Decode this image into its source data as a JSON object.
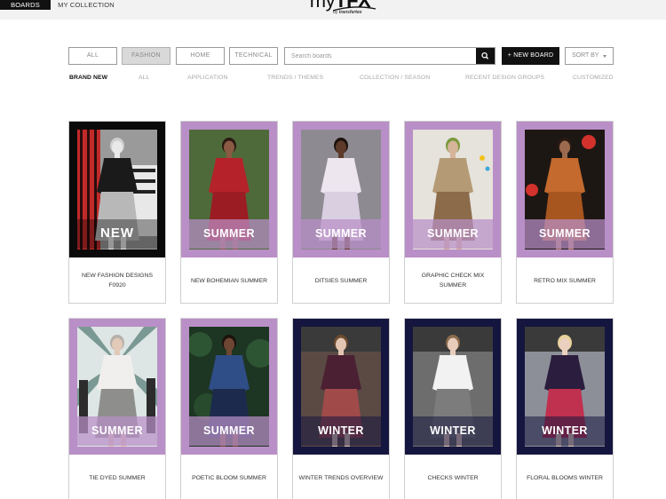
{
  "topbar": {
    "tabs": [
      {
        "label": "BOARDS",
        "active": true
      },
      {
        "label": "MY COLLECTION",
        "active": false
      }
    ],
    "logo": {
      "main_prefix": "my",
      "main_bold": "TFX",
      "sub_prefix": "by ",
      "sub_brand": "transfertex"
    }
  },
  "filters": {
    "buttons": [
      {
        "label": "ALL",
        "active": false
      },
      {
        "label": "FASHION",
        "active": true
      },
      {
        "label": "HOME",
        "active": false
      },
      {
        "label": "TECHNICAL",
        "active": false
      }
    ],
    "search": {
      "placeholder": "Search boards",
      "value": ""
    },
    "new_board_label": "+ NEW BOARD",
    "sort_label": "SORT BY"
  },
  "subtabs": [
    {
      "label": "BRAND NEW",
      "active": true
    },
    {
      "label": "ALL",
      "active": false
    },
    {
      "label": "APPLICATION",
      "active": false
    },
    {
      "label": "TRENDS / THEMES",
      "active": false
    },
    {
      "label": "COLLECTION / SEASON",
      "active": false
    },
    {
      "label": "RECENT DESIGN GROUPS",
      "active": false
    },
    {
      "label": "CUSTOMIZED",
      "active": false
    }
  ],
  "colors": {
    "summer_frame": "#b98fc7",
    "winter_frame": "#15163f",
    "new_frame": "#0a0a0a",
    "accent_black": "#111111"
  },
  "boards": [
    {
      "title": "NEW FASHION DESIGNS F0920",
      "label": "NEW",
      "theme": "new"
    },
    {
      "title": "NEW BOHEMIAN SUMMER",
      "label": "SUMMER",
      "theme": "summer"
    },
    {
      "title": "DITSIES SUMMER",
      "label": "SUMMER",
      "theme": "summer"
    },
    {
      "title": "GRAPHIC CHECK MIX SUMMER",
      "label": "SUMMER",
      "theme": "summer"
    },
    {
      "title": "RETRO MIX SUMMER",
      "label": "SUMMER",
      "theme": "summer"
    },
    {
      "title": "TIE DYED SUMMER",
      "label": "SUMMER",
      "theme": "summer"
    },
    {
      "title": "POETIC BLOOM SUMMER",
      "label": "SUMMER",
      "theme": "summer"
    },
    {
      "title": "WINTER TRENDS OVERVIEW",
      "label": "WINTER",
      "theme": "winter"
    },
    {
      "title": "CHECKS WINTER",
      "label": "WINTER",
      "theme": "winter"
    },
    {
      "title": "FLORAL BLOOMS WINTER",
      "label": "WINTER",
      "theme": "winter"
    }
  ]
}
